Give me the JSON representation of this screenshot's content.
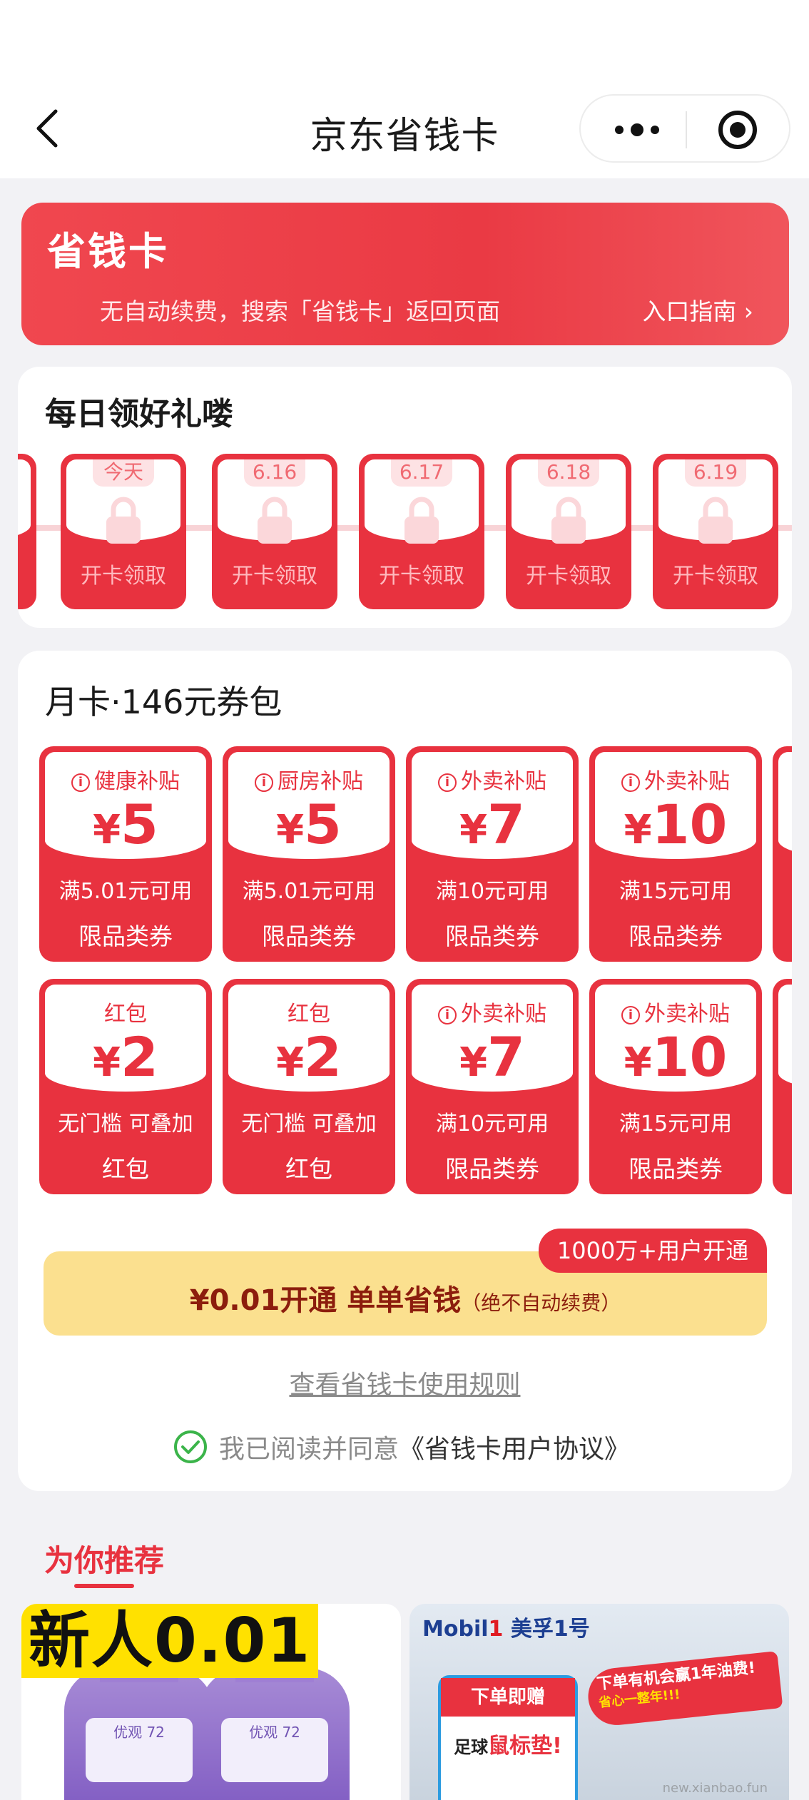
{
  "nav": {
    "title": "京东省钱卡",
    "icons": {
      "back": "chevron-left-icon",
      "more": "more-dots-icon",
      "close": "target-circle-icon"
    }
  },
  "banner": {
    "title": "省钱卡",
    "subtitle": "无自动续费，搜索「省钱卡」返回页面",
    "guide_label": "入口指南 ›"
  },
  "daily": {
    "title": "每日领好礼喽",
    "days": [
      {
        "date": "今天",
        "action": "开卡领取"
      },
      {
        "date": "6.16",
        "action": "开卡领取"
      },
      {
        "date": "6.17",
        "action": "开卡领取"
      },
      {
        "date": "6.18",
        "action": "开卡领取"
      },
      {
        "date": "6.19",
        "action": "开卡领取"
      }
    ]
  },
  "monthly": {
    "title": "月卡·146元券包",
    "coupons": [
      {
        "tag": "健康补贴",
        "info": true,
        "currency": "¥",
        "amount": "5",
        "condition": "满5.01元可用",
        "kind": "限品类券"
      },
      {
        "tag": "厨房补贴",
        "info": true,
        "currency": "¥",
        "amount": "5",
        "condition": "满5.01元可用",
        "kind": "限品类券"
      },
      {
        "tag": "外卖补贴",
        "info": true,
        "currency": "¥",
        "amount": "7",
        "condition": "满10元可用",
        "kind": "限品类券"
      },
      {
        "tag": "外卖补贴",
        "info": true,
        "currency": "¥",
        "amount": "10",
        "condition": "满15元可用",
        "kind": "限品类券"
      },
      {
        "tag": "红包",
        "info": false,
        "currency": "¥",
        "amount": "2",
        "condition": "无门槛 可叠加",
        "kind": "红包"
      },
      {
        "tag": "红包",
        "info": false,
        "currency": "¥",
        "amount": "2",
        "condition": "无门槛 可叠加",
        "kind": "红包"
      },
      {
        "tag": "外卖补贴",
        "info": true,
        "currency": "¥",
        "amount": "7",
        "condition": "满10元可用",
        "kind": "限品类券"
      },
      {
        "tag": "外卖补贴",
        "info": true,
        "currency": "¥",
        "amount": "10",
        "condition": "满15元可用",
        "kind": "限品类券"
      }
    ],
    "badge": "1000万+用户开通",
    "cta_main": "¥0.01开通 单单省钱",
    "cta_note": "（绝不自动续费）",
    "rules_link": "查看省钱卡使用规则",
    "agree_text": "我已阅读并同意",
    "agree_link": "《省钱卡用户协议》"
  },
  "recommend": {
    "title": "为你推荐",
    "products": [
      {
        "headline": "新人0.01",
        "bottle_label": "优观",
        "bottle_mark": "72"
      },
      {
        "brand": "Mobil",
        "brand_mark": "1",
        "brand_cn": "美孚1号",
        "gift_header": "下单即赠",
        "gift_text": "足球",
        "gift_highlight": "鼠标垫!",
        "promo": "下单有机会赢1年油费!",
        "promo_sub": "省心一整年!!!"
      }
    ],
    "watermark": "new.xianbao.fun"
  },
  "colors": {
    "brand_red": "#e8323f",
    "cta_yellow": "#fbe08f",
    "cta_text": "#8c1d0d"
  }
}
